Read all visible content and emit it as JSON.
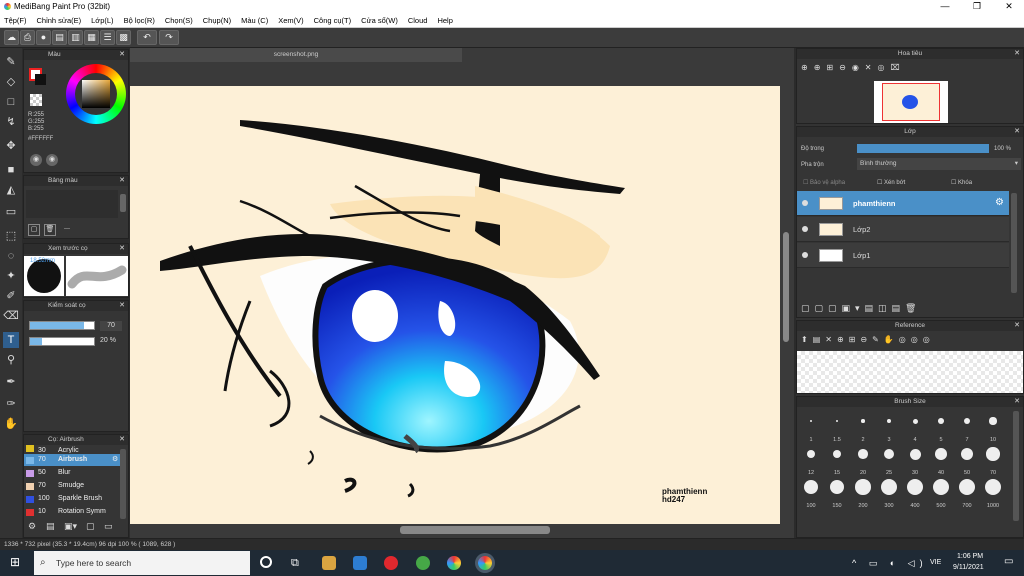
{
  "app": {
    "title": "MediBang Paint Pro (32bit)"
  },
  "menu": [
    "Tệp(F)",
    "Chỉnh sửa(E)",
    "Lớp(L)",
    "Bộ lọc(R)",
    "Chọn(S)",
    "Chụp(N)",
    "Màu (C)",
    "Xem(V)",
    "Công cụ(T)",
    "Cửa sổ(W)",
    "Cloud",
    "Help"
  ],
  "panels": {
    "color": {
      "title": "Màu",
      "rgb": [
        "R:255",
        "G:255",
        "B:255"
      ],
      "hex": "#FFFFFF"
    },
    "palette": {
      "title": "Bảng màu",
      "dash": "---"
    },
    "preview": {
      "title": "Xem trước cọ",
      "size": "18.52mm"
    },
    "control": {
      "title": "Kiểm soát cọ",
      "size_val": "70",
      "opacity_val": "20 %"
    },
    "brushes": {
      "title": "Cọ: Airbrush",
      "items": [
        {
          "size": "30",
          "name": "Acrylic",
          "color": "#e0c020"
        },
        {
          "size": "70",
          "name": "Airbrush",
          "color": "#7ab8e8",
          "selected": true
        },
        {
          "size": "50",
          "name": "Blur",
          "color": "#c89be8"
        },
        {
          "size": "70",
          "name": "Smudge",
          "color": "#f0d0b0"
        },
        {
          "size": "100",
          "name": "Sparkle Brush",
          "color": "#3050e0"
        },
        {
          "size": "10",
          "name": "Rotation Symm",
          "color": "#e03030"
        }
      ]
    },
    "navigator": {
      "title": "Hoa tiêu"
    },
    "layers": {
      "title": "Lớp",
      "opacity_label": "Độ trong",
      "opacity_value": "100 %",
      "blend_label": "Pha trộn",
      "blend_value": "Bình thường",
      "protect_alpha": "Bảo vệ alpha",
      "clipping": "Xén bớt",
      "lock": "Khóa",
      "items": [
        {
          "name": "phamthienn",
          "selected": true
        },
        {
          "name": "Lớp2",
          "selected": false
        },
        {
          "name": "Lớp1",
          "selected": false
        }
      ]
    },
    "reference": {
      "title": "Reference"
    },
    "brush_size": {
      "title": "Brush Size",
      "sizes": [
        "1",
        "1.5",
        "2",
        "3",
        "4",
        "5",
        "7",
        "10",
        "12",
        "15",
        "20",
        "25",
        "30",
        "40",
        "50",
        "70",
        "100",
        "150",
        "200",
        "300",
        "400",
        "500",
        "700",
        "1000"
      ]
    }
  },
  "canvas": {
    "tab": "screenshot.png",
    "signature_line1": "phamthienn",
    "signature_line2": "hd247"
  },
  "status": "1336 * 732 pixel  (35.3 * 19.4cm)  96 dpi  100 %  ( 1089, 628 )",
  "taskbar": {
    "search_placeholder": "Type here to search",
    "time": "1:06 PM",
    "date": "9/11/2021",
    "lang": "VIE"
  }
}
